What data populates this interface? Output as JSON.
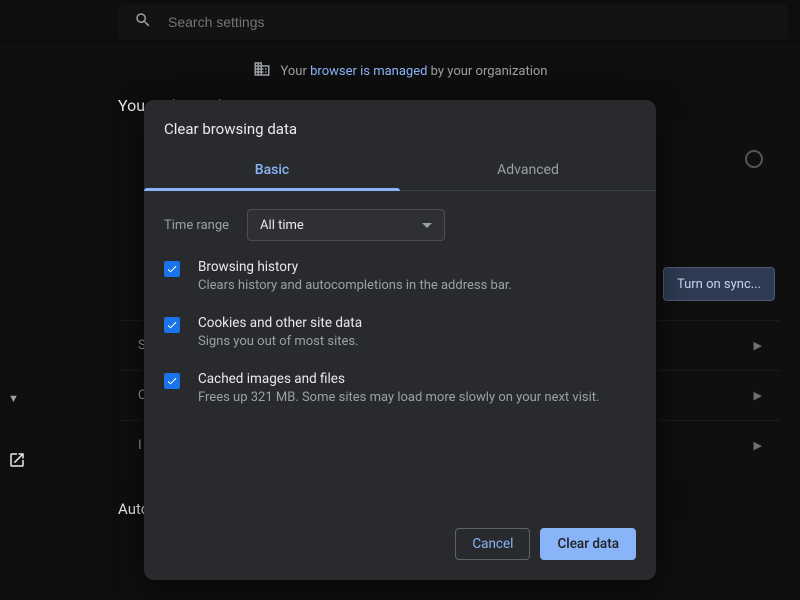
{
  "search": {
    "placeholder": "Search settings"
  },
  "managed": {
    "prefix": "Your ",
    "link": "browser is managed",
    "suffix": " by your organization"
  },
  "background": {
    "section_heading": "You and Google",
    "sync_button": "Turn on sync...",
    "autofill_heading": "Autofill"
  },
  "dialog": {
    "title": "Clear browsing data",
    "tabs": {
      "basic": "Basic",
      "advanced": "Advanced"
    },
    "time_label": "Time range",
    "time_selected": "All time",
    "options": [
      {
        "title": "Browsing history",
        "desc": "Clears history and autocompletions in the address bar."
      },
      {
        "title": "Cookies and other site data",
        "desc": "Signs you out of most sites."
      },
      {
        "title": "Cached images and files",
        "desc": "Frees up 321 MB. Some sites may load more slowly on your next visit."
      }
    ],
    "buttons": {
      "cancel": "Cancel",
      "clear": "Clear data"
    }
  }
}
